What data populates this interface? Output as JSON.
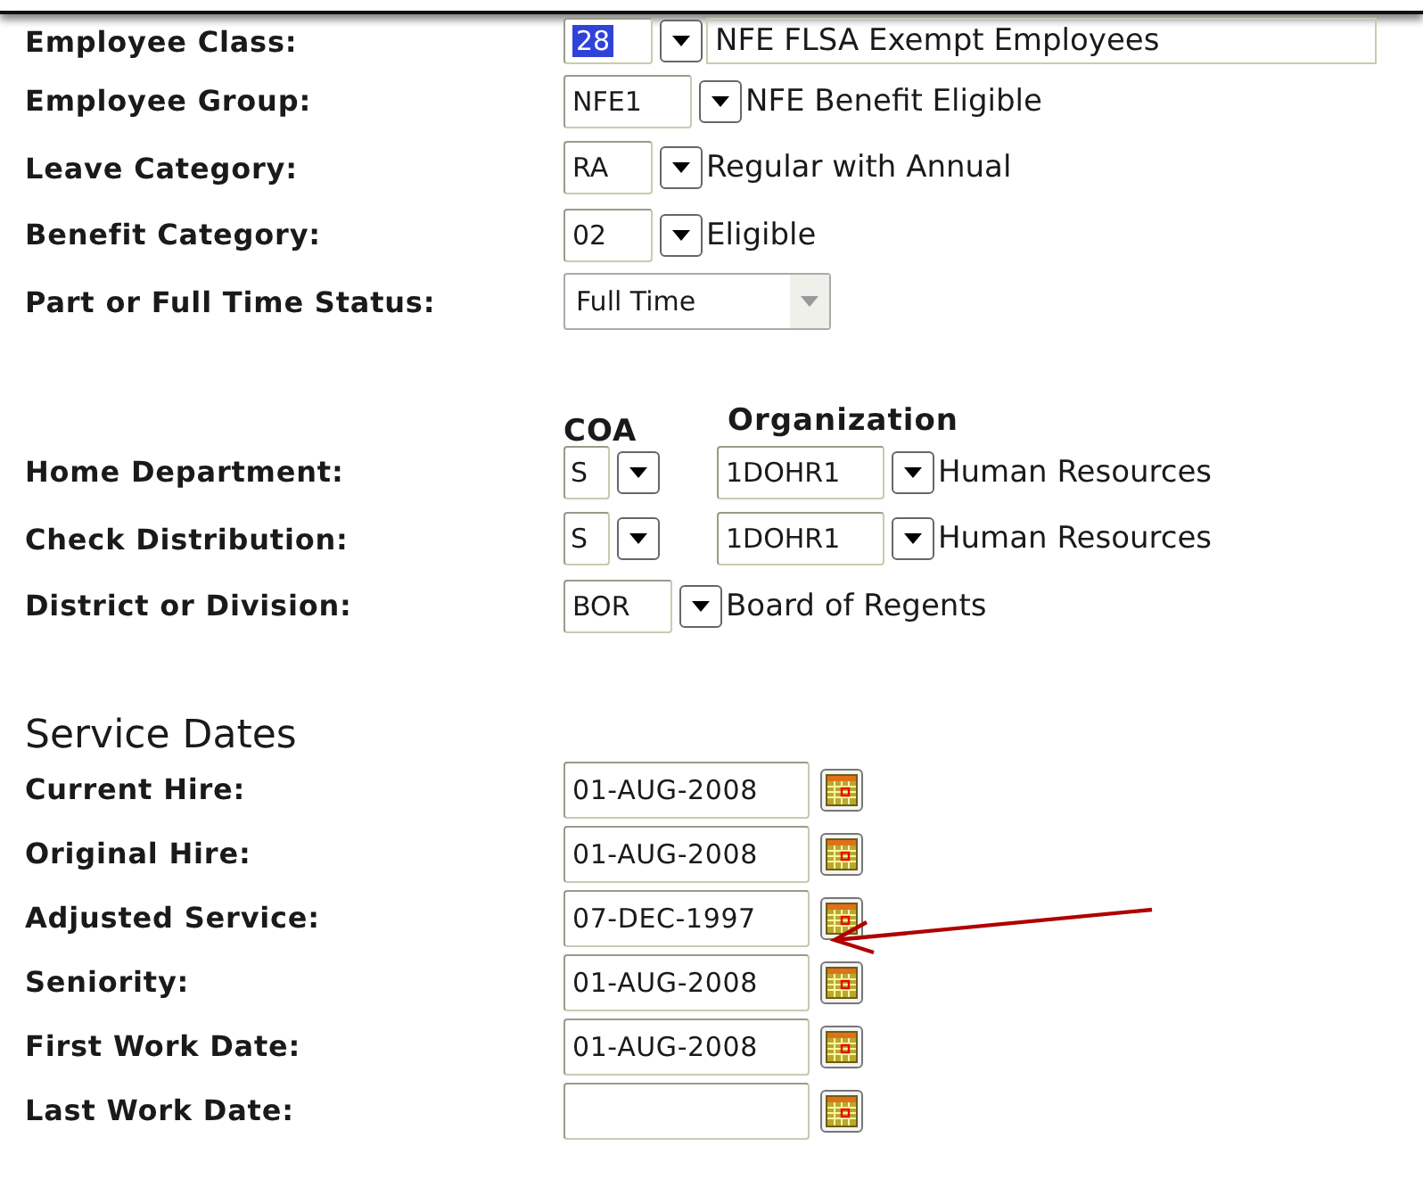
{
  "fields": [
    {
      "kind": "code-lookup-wide",
      "label": "Employee Class:",
      "code": "28",
      "code_highlighted": true,
      "description": "NFE FLSA Exempt Employees"
    },
    {
      "kind": "code-lookup",
      "label": "Employee Group:",
      "code": "NFE1",
      "description": "NFE Benefit Eligible"
    },
    {
      "kind": "code-lookup",
      "label": "Leave Category:",
      "code": "RA",
      "description": "Regular with Annual"
    },
    {
      "kind": "code-lookup",
      "label": "Benefit Category:",
      "code": "02",
      "description": "Eligible"
    },
    {
      "kind": "select",
      "label": "Part or Full Time Status:",
      "value": "Full Time"
    }
  ],
  "org_headers": {
    "coa": "COA",
    "organization": "Organization"
  },
  "org_fields": [
    {
      "kind": "coa-org",
      "label": "Home Department:",
      "coa": "S",
      "code": "1DOHR1",
      "description": "Human Resources"
    },
    {
      "kind": "coa-org",
      "label": "Check Distribution:",
      "coa": "S",
      "code": "1DOHR1",
      "description": "Human Resources"
    },
    {
      "kind": "code-lookup",
      "label": "District or Division:",
      "code": "BOR",
      "description": "Board of Regents"
    }
  ],
  "service_dates": {
    "title": "Service Dates",
    "fields": [
      {
        "label": "Current Hire:",
        "value": "01-AUG-2008"
      },
      {
        "label": "Original Hire:",
        "value": "01-AUG-2008"
      },
      {
        "label": "Adjusted Service:",
        "value": "07-DEC-1997"
      },
      {
        "label": "Seniority:",
        "value": "01-AUG-2008"
      },
      {
        "label": "First Work Date:",
        "value": "01-AUG-2008"
      },
      {
        "label": "Last Work Date:"
      }
    ]
  }
}
